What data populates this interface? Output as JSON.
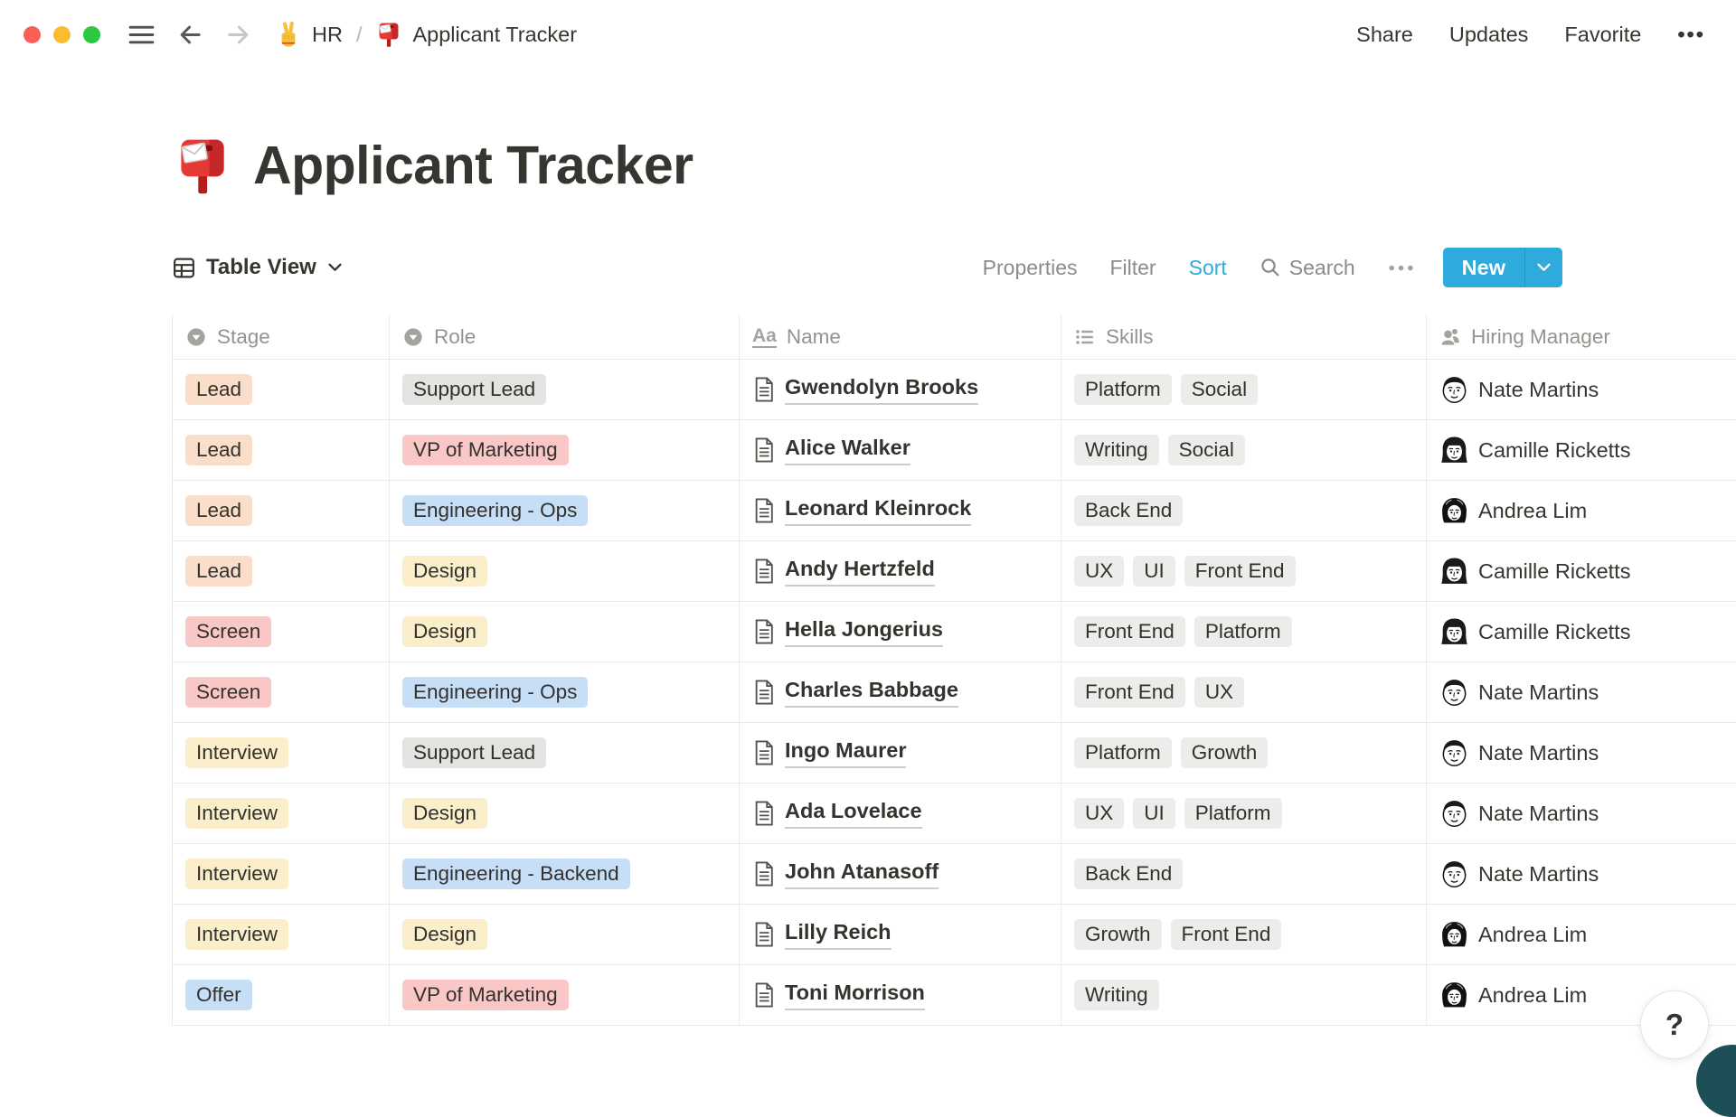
{
  "window": {
    "controls": [
      "close",
      "minimize",
      "zoom"
    ],
    "breadcrumb": {
      "workspace_icon": "victory-hand-icon",
      "workspace": "HR",
      "separator": "/",
      "page_icon": "mailbox-icon",
      "page": "Applicant Tracker"
    },
    "actions": [
      "Share",
      "Updates",
      "Favorite",
      "•••"
    ]
  },
  "title": {
    "icon": "mailbox-icon",
    "text": "Applicant Tracker"
  },
  "toolbar": {
    "view_icon": "table-grid-icon",
    "view_label": "Table View",
    "properties_label": "Properties",
    "filter_label": "Filter",
    "sort_label": "Sort",
    "search_icon": "search-icon",
    "search_label": "Search",
    "more_label": "•••",
    "new_label": "New"
  },
  "colors": {
    "accent_blue": "#2EAADC",
    "tag_orange": "#FADEC9",
    "tag_yellow": "#FBEECA",
    "tag_red": "#F9C7C6",
    "tag_blue": "#C7DEF7",
    "tag_gray": "#E4E3E1",
    "tag_skill_gray": "#ECECEA",
    "border": "#E9E9E7",
    "text_dark": "#37352F",
    "text_gray": "#908F8B",
    "corner_bubble_teal": "#1D4F57"
  },
  "table": {
    "columns": [
      {
        "label": "Stage",
        "icon": "select-property-icon"
      },
      {
        "label": "Role",
        "icon": "select-property-icon"
      },
      {
        "label": "Name",
        "icon": "text-property-icon",
        "icon_text": "Aa"
      },
      {
        "label": "Skills",
        "icon": "multiselect-list-icon"
      },
      {
        "label": "Hiring Manager",
        "icon": "person-icon"
      }
    ],
    "rows": [
      {
        "stage": {
          "label": "Lead",
          "color": "orange"
        },
        "role": {
          "label": "Support Lead",
          "color": "gray"
        },
        "name": "Gwendolyn Brooks",
        "skills": [
          "Platform",
          "Social"
        ],
        "manager": {
          "name": "Nate Martins",
          "avatar": "nate"
        }
      },
      {
        "stage": {
          "label": "Lead",
          "color": "orange"
        },
        "role": {
          "label": "VP of Marketing",
          "color": "red"
        },
        "name": "Alice Walker",
        "skills": [
          "Writing",
          "Social"
        ],
        "manager": {
          "name": "Camille Ricketts",
          "avatar": "camille"
        }
      },
      {
        "stage": {
          "label": "Lead",
          "color": "orange"
        },
        "role": {
          "label": "Engineering - Ops",
          "color": "blue"
        },
        "name": "Leonard Kleinrock",
        "skills": [
          "Back End"
        ],
        "manager": {
          "name": "Andrea Lim",
          "avatar": "andrea"
        }
      },
      {
        "stage": {
          "label": "Lead",
          "color": "orange"
        },
        "role": {
          "label": "Design",
          "color": "yellow"
        },
        "name": "Andy Hertzfeld",
        "skills": [
          "UX",
          "UI",
          "Front End"
        ],
        "manager": {
          "name": "Camille Ricketts",
          "avatar": "camille"
        }
      },
      {
        "stage": {
          "label": "Screen",
          "color": "red"
        },
        "role": {
          "label": "Design",
          "color": "yellow"
        },
        "name": "Hella Jongerius",
        "skills": [
          "Front End",
          "Platform"
        ],
        "manager": {
          "name": "Camille Ricketts",
          "avatar": "camille"
        }
      },
      {
        "stage": {
          "label": "Screen",
          "color": "red"
        },
        "role": {
          "label": "Engineering - Ops",
          "color": "blue"
        },
        "name": "Charles Babbage",
        "skills": [
          "Front End",
          "UX"
        ],
        "manager": {
          "name": "Nate Martins",
          "avatar": "nate"
        }
      },
      {
        "stage": {
          "label": "Interview",
          "color": "yellow"
        },
        "role": {
          "label": "Support Lead",
          "color": "gray"
        },
        "name": "Ingo Maurer",
        "skills": [
          "Platform",
          "Growth"
        ],
        "manager": {
          "name": "Nate Martins",
          "avatar": "nate"
        }
      },
      {
        "stage": {
          "label": "Interview",
          "color": "yellow"
        },
        "role": {
          "label": "Design",
          "color": "yellow"
        },
        "name": "Ada Lovelace",
        "skills": [
          "UX",
          "UI",
          "Platform"
        ],
        "manager": {
          "name": "Nate Martins",
          "avatar": "nate"
        }
      },
      {
        "stage": {
          "label": "Interview",
          "color": "yellow"
        },
        "role": {
          "label": "Engineering - Backend",
          "color": "blue"
        },
        "name": "John Atanasoff",
        "skills": [
          "Back End"
        ],
        "manager": {
          "name": "Nate Martins",
          "avatar": "nate"
        }
      },
      {
        "stage": {
          "label": "Interview",
          "color": "yellow"
        },
        "role": {
          "label": "Design",
          "color": "yellow"
        },
        "name": "Lilly Reich",
        "skills": [
          "Growth",
          "Front End"
        ],
        "manager": {
          "name": "Andrea Lim",
          "avatar": "andrea"
        }
      },
      {
        "stage": {
          "label": "Offer",
          "color": "blue"
        },
        "role": {
          "label": "VP of Marketing",
          "color": "red"
        },
        "name": "Toni Morrison",
        "skills": [
          "Writing"
        ],
        "manager": {
          "name": "Andrea Lim",
          "avatar": "andrea"
        }
      }
    ]
  },
  "help_button": {
    "label": "?"
  }
}
